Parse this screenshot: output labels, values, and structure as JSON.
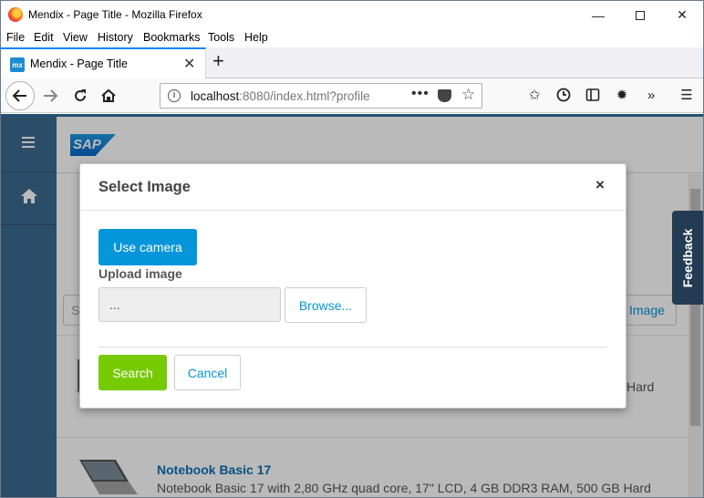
{
  "window": {
    "title": "Mendix - Page Title - Mozilla Firefox",
    "minimize": "—",
    "close": "✕"
  },
  "menu": {
    "items": [
      "File",
      "Edit",
      "View",
      "History",
      "Bookmarks",
      "Tools",
      "Help"
    ]
  },
  "tabs": [
    {
      "label": "Mendix - Page Title",
      "favicon": "mx",
      "close": "✕"
    }
  ],
  "new_tab": "+",
  "address_bar": {
    "host": "localhost",
    "rest": ":8080/index.html?profile",
    "more": "•••"
  },
  "page": {
    "brand_logo": "SAP",
    "search_placeholder": "S",
    "find_image_label": "l Image",
    "product_top_desc": "Hard",
    "product_name": "Notebook Basic 17",
    "product_desc": "Notebook Basic 17 with 2,80 GHz quad core, 17\" LCD, 4 GB DDR3 RAM, 500 GB Hard",
    "feedback_label": "Feedback"
  },
  "modal": {
    "title": "Select Image",
    "close": "×",
    "use_camera": "Use camera",
    "upload_label": "Upload image",
    "file_value": "...",
    "browse": "Browse...",
    "search": "Search",
    "cancel": "Cancel"
  },
  "colors": {
    "primary": "#0595db",
    "success": "#76ca02",
    "sidebar": "#3d6a8f",
    "feedback": "#233b53"
  }
}
